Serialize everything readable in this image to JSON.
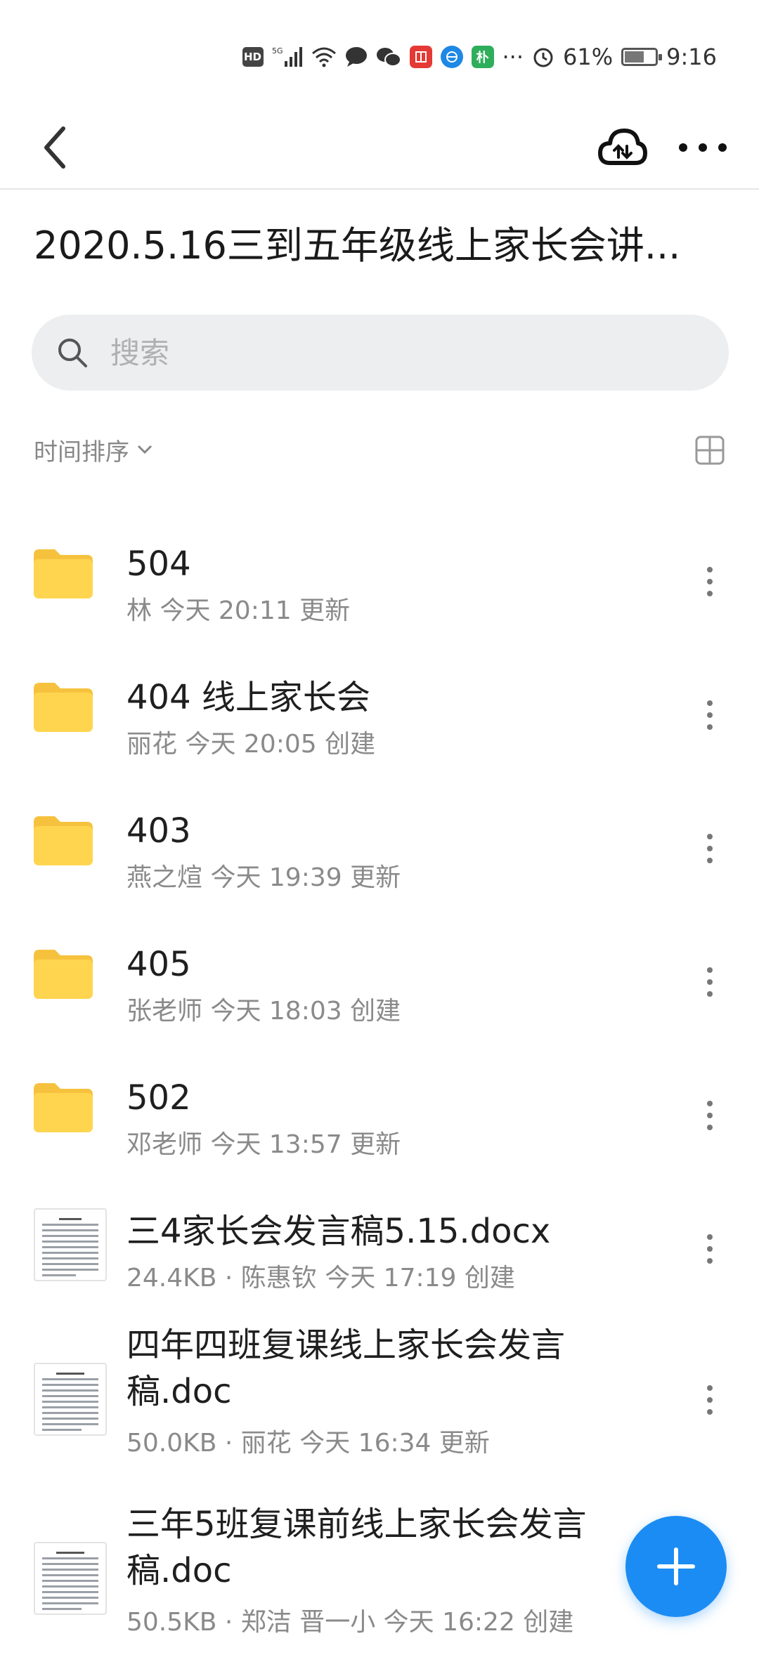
{
  "status_bar": {
    "hd_badge": "HD",
    "network": "5G",
    "app_badge": "朴",
    "more": "···",
    "battery_percent": "61%",
    "battery_level": 0.61,
    "time": "9:16"
  },
  "header": {
    "back_icon": "back-arrow-icon",
    "cloud_icon": "cloud-sync-icon",
    "more_icon": "more-dots-icon"
  },
  "title": "2020.5.16三到五年级线上家长会讲...",
  "search": {
    "placeholder": "搜索",
    "value": ""
  },
  "sort": {
    "label": "时间排序",
    "view_icon": "grid-view-icon"
  },
  "files": [
    {
      "type": "folder",
      "name": "504",
      "meta": "林 今天 20:11 更新"
    },
    {
      "type": "folder",
      "name": "404 线上家长会",
      "meta": "丽花 今天 20:05 创建"
    },
    {
      "type": "folder",
      "name": "403",
      "meta": "燕之煊 今天 19:39 更新"
    },
    {
      "type": "folder",
      "name": "405",
      "meta": "张老师 今天 18:03 创建"
    },
    {
      "type": "folder",
      "name": "502",
      "meta": "邓老师 今天 13:57 更新"
    },
    {
      "type": "doc",
      "name": "三4家长会发言稿5.15.docx",
      "meta": "24.4KB · 陈惠钦 今天 17:19 创建"
    },
    {
      "type": "doc",
      "name": "四年四班复课线上家长会发言稿.doc",
      "meta": "50.0KB · 丽花 今天 16:34 更新"
    },
    {
      "type": "doc",
      "name": "三年5班复课前线上家长会发言稿.doc",
      "meta": "50.5KB · 郑洁 晋一小 今天 16:22 创建"
    }
  ],
  "fab_icon": "plus-icon",
  "colors": {
    "accent": "#1b8cf3",
    "folder": "#ffd54f"
  }
}
